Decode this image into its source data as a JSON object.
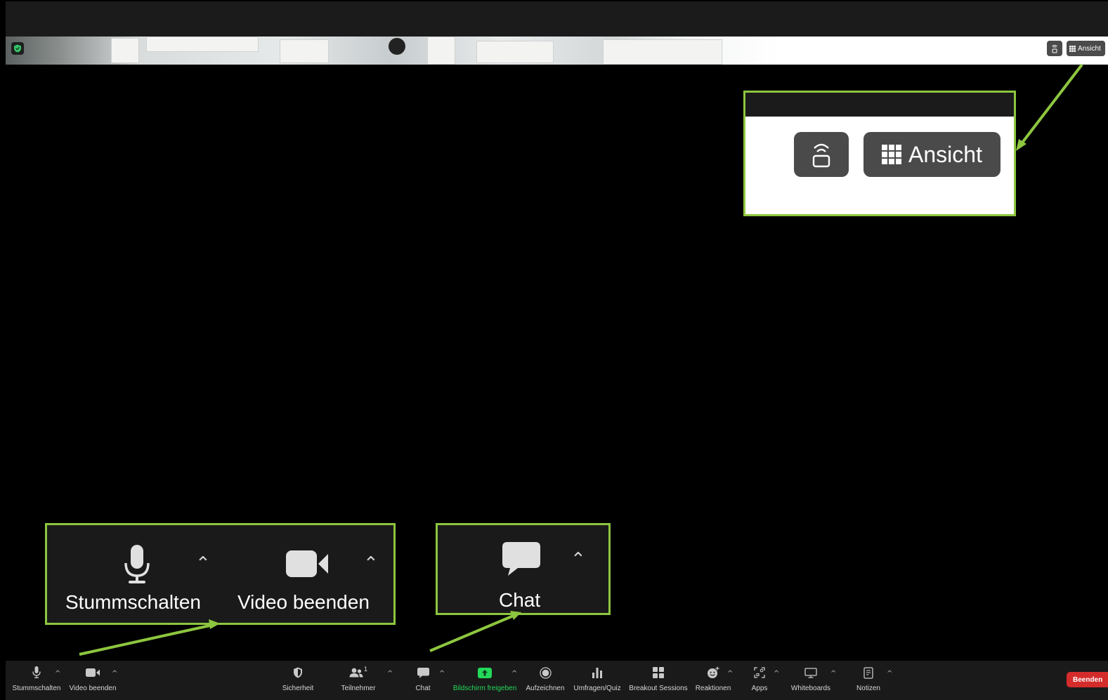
{
  "top_right": {
    "view_label": "Ansicht"
  },
  "zoom_callout": {
    "view_label": "Ansicht"
  },
  "callout_audio_video": {
    "mute_label": "Stummschalten",
    "video_label": "Video beenden"
  },
  "callout_chat": {
    "chat_label": "Chat"
  },
  "toolbar": {
    "mute": "Stummschalten",
    "video": "Video beenden",
    "security": "Sicherheit",
    "participants": "Teilnehmer",
    "participants_count": "1",
    "chat": "Chat",
    "share_screen": "Bildschirm freigeben",
    "record": "Aufzeichnen",
    "polls": "Umfragen/Quiz",
    "breakout": "Breakout Sessions",
    "reactions": "Reaktionen",
    "apps": "Apps",
    "whiteboards": "Whiteboards",
    "notes": "Notizen",
    "end": "Beenden"
  },
  "colors": {
    "highlight": "#8dc63f",
    "share_green": "#23d959",
    "end_red": "#d42b2b",
    "toolbar_bg": "#1a1a1a"
  },
  "icons": [
    "shield-icon",
    "privacy-icon",
    "grid-icon",
    "microphone-icon",
    "camera-icon",
    "chat-bubble-icon",
    "security-shield-icon",
    "participants-icon",
    "share-screen-icon",
    "record-icon",
    "poll-icon",
    "breakout-icon",
    "reactions-icon",
    "apps-icon",
    "whiteboard-icon",
    "notes-icon"
  ]
}
